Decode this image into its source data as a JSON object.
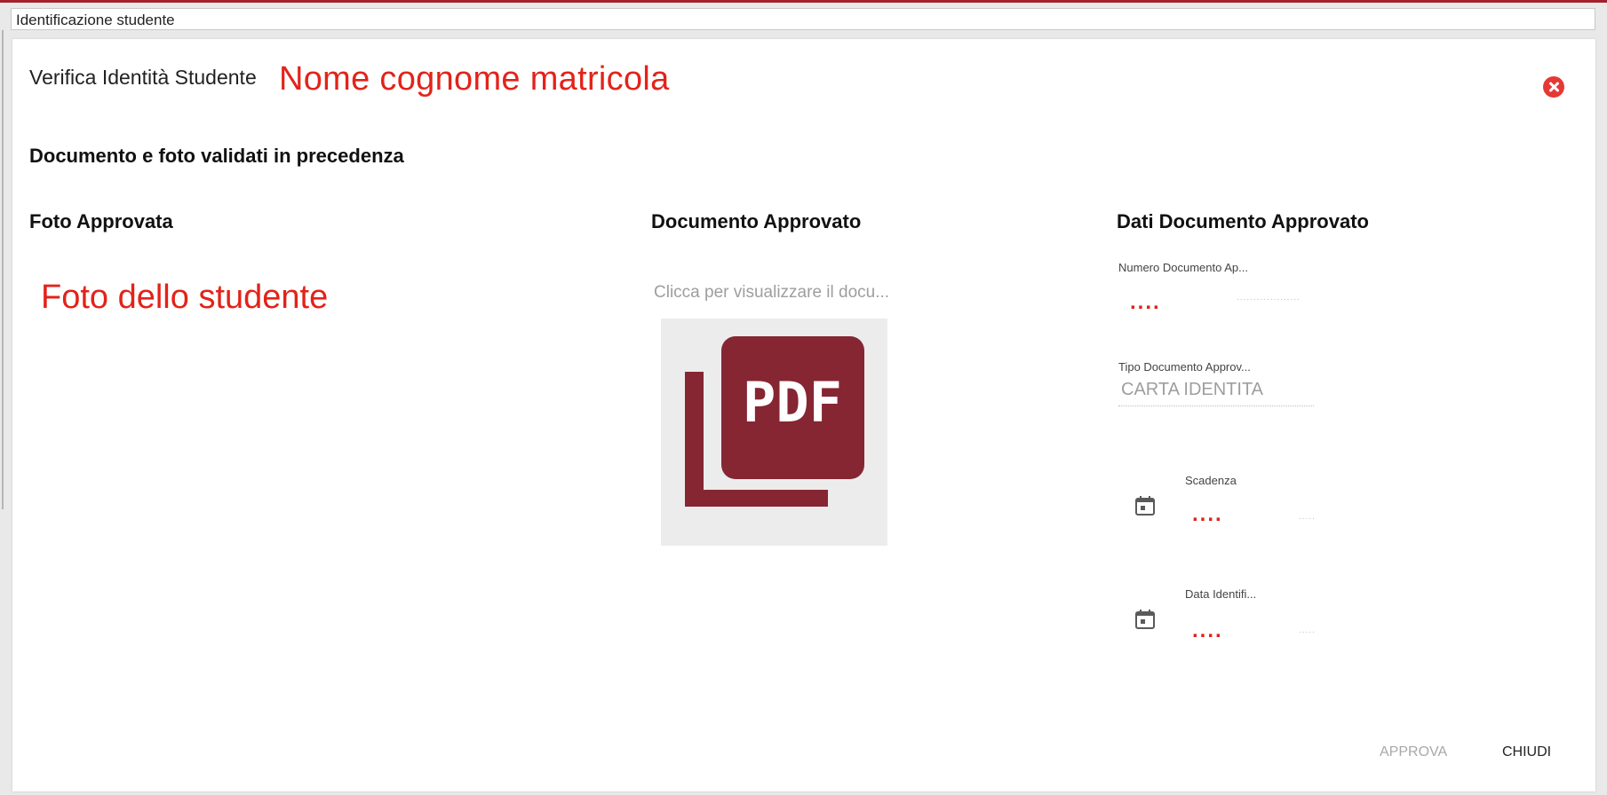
{
  "window": {
    "title": "Identificazione studente"
  },
  "dialog": {
    "title": "Verifica Identità Studente",
    "annotation_name": "Nome cognome matricola",
    "section_heading": "Documento e foto validati in precedenza",
    "close_icon": "close-circle-icon"
  },
  "photo_column": {
    "heading": "Foto Approvata",
    "annotation": "Foto dello studente"
  },
  "document_column": {
    "heading": "Documento Approvato",
    "link_text": "Clicca per visualizzare il docu...",
    "thumbnail_label": "PDF",
    "thumbnail_color": "#862633"
  },
  "data_column": {
    "heading": "Dati Documento Approvato",
    "fields": {
      "numero": {
        "label": "Numero Documento Ap...",
        "value": "...."
      },
      "tipo": {
        "label": "Tipo Documento Approv...",
        "value": "CARTA IDENTITA"
      },
      "scadenza": {
        "label": "Scadenza",
        "value": "....",
        "icon": "calendar-icon"
      },
      "data_identificazione": {
        "label": "Data Identifi...",
        "value": "....",
        "icon": "calendar-icon"
      }
    }
  },
  "actions": {
    "approve_label": "APPROVA",
    "close_label": "CHIUDI"
  },
  "colors": {
    "accent": "#a3202c",
    "annotation_red": "#e2231a",
    "close_button": "#e53935"
  }
}
